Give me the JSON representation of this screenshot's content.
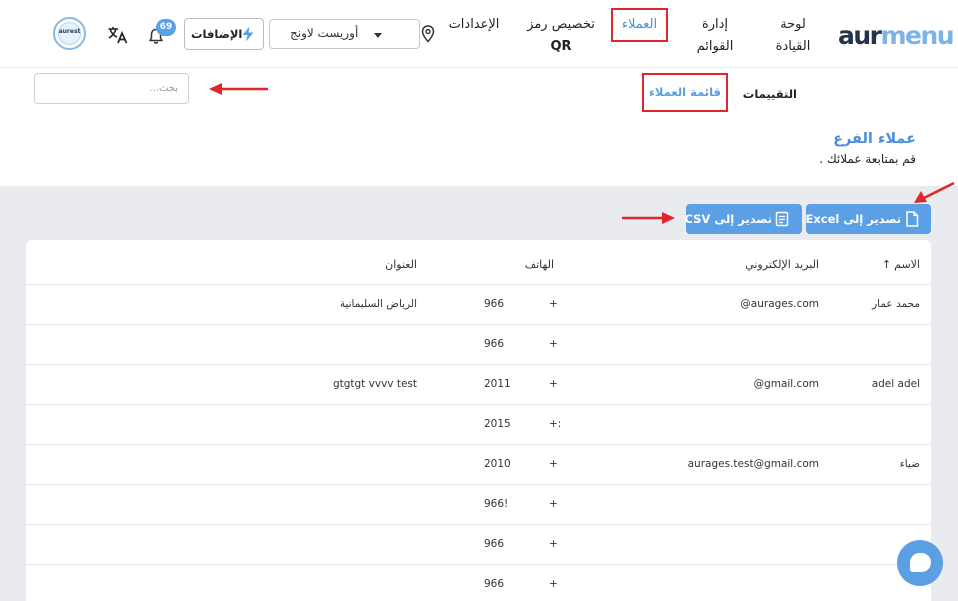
{
  "header": {
    "logo": {
      "part1": "aur",
      "part2": "menu"
    },
    "nav": {
      "dashboard_line1": "لوحة",
      "dashboard_line2": "القيادة",
      "menus_line1": "إدارة",
      "menus_line2": "القوائم",
      "customers": "العملاء",
      "qr_line1": "تخصيص رمز",
      "qr_line2": "QR",
      "settings": "الإعدادات"
    },
    "branch_select": {
      "value": "أوريست لاونج"
    },
    "addons_label": "الإضافات",
    "notification_count": "69",
    "avatar_text": "aurest"
  },
  "subnav": {
    "search_placeholder": "بحث...",
    "tab_customers": "قائمة العملاء",
    "tab_ratings": "التقييمات"
  },
  "section": {
    "title": "عملاء الفرع",
    "subtitle": "قم بمتابعة عملائك ."
  },
  "toolbar": {
    "export_excel": "تصدير إلى Excel",
    "export_csv": "تصدير إلى CSV"
  },
  "table": {
    "headers": {
      "name": "الاسم",
      "email": "البريد الإلكتروني",
      "phone": "الهاتف",
      "address": "العنوان"
    },
    "rows": [
      {
        "name": "محمد عمار",
        "email": "@aurages.com",
        "plus": "+",
        "phone": "966",
        "address": "الرياض السليمانية"
      },
      {
        "name": "",
        "email": "",
        "plus": "+",
        "phone": "966",
        "address": ""
      },
      {
        "name": "adel adel",
        "email": "@gmail.com",
        "plus": "+",
        "phone": "2011",
        "address": "gtgtgt vvvv test"
      },
      {
        "name": "",
        "email": "",
        "plus": "+:",
        "phone": "2015",
        "address": ""
      },
      {
        "name": "ضياء",
        "email": "aurages.test@gmail.com",
        "plus": "+",
        "phone": "2010",
        "address": ""
      },
      {
        "name": "",
        "email": "",
        "plus": "+",
        "phone": "966!",
        "address": ""
      },
      {
        "name": "",
        "email": "",
        "plus": "+",
        "phone": "966",
        "address": ""
      },
      {
        "name": "",
        "email": "",
        "plus": "+",
        "phone": "966",
        "address": ""
      }
    ]
  },
  "colors": {
    "accent": "#5b9fe4",
    "highlight_box": "#e0252c",
    "content_bg": "#e9ebee"
  }
}
